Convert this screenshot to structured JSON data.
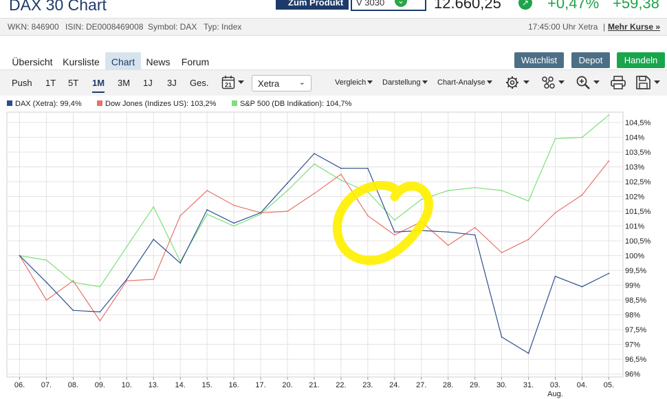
{
  "header": {
    "title": "DAX 30 Chart",
    "zum_produkt": "Zum Produkt",
    "product_select": "V 3030",
    "price": "12.660,25",
    "change_pct": "+0,47%",
    "change_abs": "+59,38",
    "up_icon": "arrow-up-circle-icon"
  },
  "info": {
    "wkn": "WKN: 846900",
    "isin": "ISIN: DE0008469008",
    "symbol": "Symbol: DAX",
    "typ": "Typ: Index",
    "time": "17:45:00 Uhr Xetra",
    "sep": "|",
    "mehr": "Mehr Kurse »"
  },
  "nav": {
    "tabs": [
      "Übersicht",
      "Kursliste",
      "Chart",
      "News",
      "Forum"
    ],
    "active": "Chart"
  },
  "actions": {
    "watchlist": "Watchlist",
    "depot": "Depot",
    "handeln": "Handeln",
    "colors": {
      "watchlist": "#4d6f86",
      "depot": "#4d6f86",
      "handeln": "#1aa54d"
    }
  },
  "toolbar": {
    "push": "Push",
    "ranges": [
      "1T",
      "5T",
      "1M",
      "3M",
      "1J",
      "3J",
      "Ges."
    ],
    "active_range": "1M",
    "calendar_icon": "calendar-icon",
    "calendar_day": "21",
    "exchange": "Xetra",
    "vergleich": "Vergleich",
    "darstellung": "Darstellung",
    "chart_analyse": "Chart-Analyse",
    "icons": [
      "settings-icon",
      "indicators-icon",
      "zoom-icon",
      "print-icon",
      "save-icon"
    ]
  },
  "chart_data": {
    "type": "line",
    "x": [
      "06.",
      "07.",
      "08.",
      "09.",
      "10.",
      "13.",
      "14.",
      "15.",
      "16.",
      "17.",
      "20.",
      "21.",
      "22.",
      "23.",
      "24.",
      "27.",
      "28.",
      "29.",
      "30.",
      "31.",
      "03.",
      "04.",
      "05."
    ],
    "x_sublabels": {
      "20": "Aug."
    },
    "ylim": [
      95.9,
      104.85
    ],
    "yticks": [
      96,
      96.5,
      97,
      97.5,
      98,
      98.5,
      99,
      99.5,
      100,
      100.5,
      101,
      101.5,
      102,
      102.5,
      103,
      103.5,
      104,
      104.5
    ],
    "ytick_labels": [
      "96%",
      "96,5%",
      "97%",
      "97,5%",
      "98%",
      "98,5%",
      "99%",
      "99,5%",
      "100%",
      "100,5%",
      "101%",
      "101,5%",
      "102%",
      "102,5%",
      "103%",
      "103,5%",
      "104%",
      "104,5%"
    ],
    "grid": true,
    "legend_position": "top-left",
    "series": [
      {
        "name": "DAX (Xetra): 99,4%",
        "color": "#2e4f8f",
        "values": [
          100.0,
          99.1,
          98.15,
          98.1,
          99.2,
          100.55,
          99.75,
          101.55,
          101.1,
          101.45,
          102.45,
          103.45,
          102.95,
          102.95,
          100.8,
          100.85,
          100.8,
          100.7,
          97.25,
          96.7,
          99.3,
          98.95,
          99.4
        ]
      },
      {
        "name": "Dow Jones (Indizes US): 103,2%",
        "color": "#e8726c",
        "values": [
          100.0,
          98.5,
          99.15,
          97.8,
          99.15,
          99.2,
          101.35,
          102.2,
          101.7,
          101.45,
          101.5,
          102.1,
          102.75,
          101.35,
          100.7,
          101.15,
          100.35,
          100.95,
          100.1,
          100.55,
          101.45,
          102.05,
          103.2
        ]
      },
      {
        "name": "S&P 500 (DB Indikation): 104,7%",
        "color": "#7de07a",
        "values": [
          100.0,
          99.85,
          99.1,
          98.95,
          100.3,
          101.65,
          99.8,
          101.4,
          101.0,
          101.4,
          102.2,
          103.1,
          102.55,
          102.15,
          101.2,
          101.9,
          102.2,
          102.3,
          102.2,
          101.85,
          103.95,
          104.0,
          104.75
        ]
      }
    ],
    "highlight_color": "#fff000"
  }
}
